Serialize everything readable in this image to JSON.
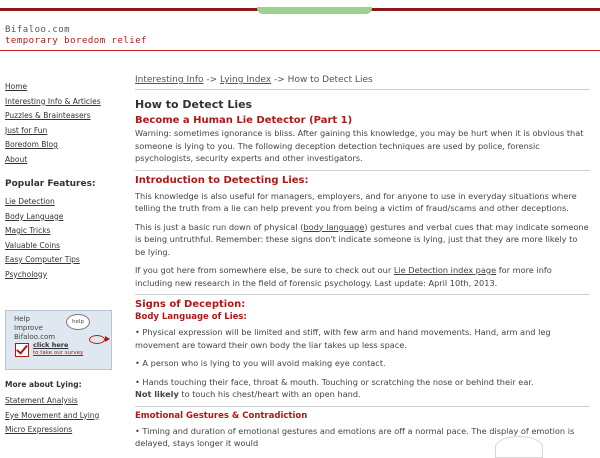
{
  "site": {
    "name": "Bifaloo.com",
    "tagline": "temporary boredom relief"
  },
  "sidebar": {
    "nav": [
      "Home",
      "Interesting Info & Articles",
      "Puzzles & Brainteasers",
      "Just for Fun",
      "Boredom Blog",
      "About"
    ],
    "popular_title": "Popular Features:",
    "popular": [
      "Lie Detection",
      "Body Language",
      "Magic Tricks",
      "Valuable Coins",
      "Easy Computer Tips",
      "Psychology"
    ],
    "help": {
      "line1": "Help",
      "line2": "Improve",
      "line3": "Bifaloo.com",
      "bubble": "help",
      "click": "click here",
      "take": "to take our survey"
    },
    "more_title": "More about Lying:",
    "more": [
      "Statement Analysis",
      "Eye Movement and Lying",
      "Micro Expressions"
    ]
  },
  "breadcrumb": {
    "c1": "Interesting Info",
    "sep": "->",
    "c2": "Lying Index",
    "current": "How to Detect Lies"
  },
  "article": {
    "title": "How to Detect Lies",
    "subtitle": "Become a Human Lie Detector (Part 1)",
    "warning": "Warning: sometimes ignorance is bliss. After gaining this knowledge, you may be hurt when it is obvious that someone is lying to you. The following deception detection techniques are used by police, forensic psychologists, security experts and other investigators.",
    "intro_head": "Introduction to Detecting Lies:",
    "intro_p1": "This knowledge is also useful for managers, employers, and for anyone to use in everyday situations where telling the truth from a lie can help prevent you from being a victim of fraud/scams and other deceptions.",
    "intro_p2_a": "This is just a basic run down of physical (",
    "intro_p2_link": "body language",
    "intro_p2_b": ") gestures and verbal cues that may indicate someone is being untruthful. Remember: these signs don't indicate someone is lying, just that they are more likely to be lying.",
    "intro_p3_a": "If you got here from somewhere else, be sure to check out our ",
    "intro_p3_link": "Lie Detection index page",
    "intro_p3_b": " for more info including new research in the field of forensic psychology. Last update: April 10th, 2013.",
    "signs_head": "Signs of Deception:",
    "body_head": "Body Language of Lies:",
    "b1": "• Physical expression will be limited and stiff, with few arm and hand movements. Hand, arm and leg movement are toward their own body the liar takes up less space.",
    "b2": "• A person who is lying to you will avoid making eye contact.",
    "b3": "• Hands touching their face, throat & mouth. Touching or scratching the nose or behind their ear.",
    "b3_bold": "Not likely",
    "b3_rest": " to touch his chest/heart with an open hand.",
    "emo_head": "Emotional Gestures & Contradiction",
    "e1": "• Timing and duration of emotional gestures and emotions are off a normal pace. The display of emotion is delayed, stays longer it would"
  }
}
